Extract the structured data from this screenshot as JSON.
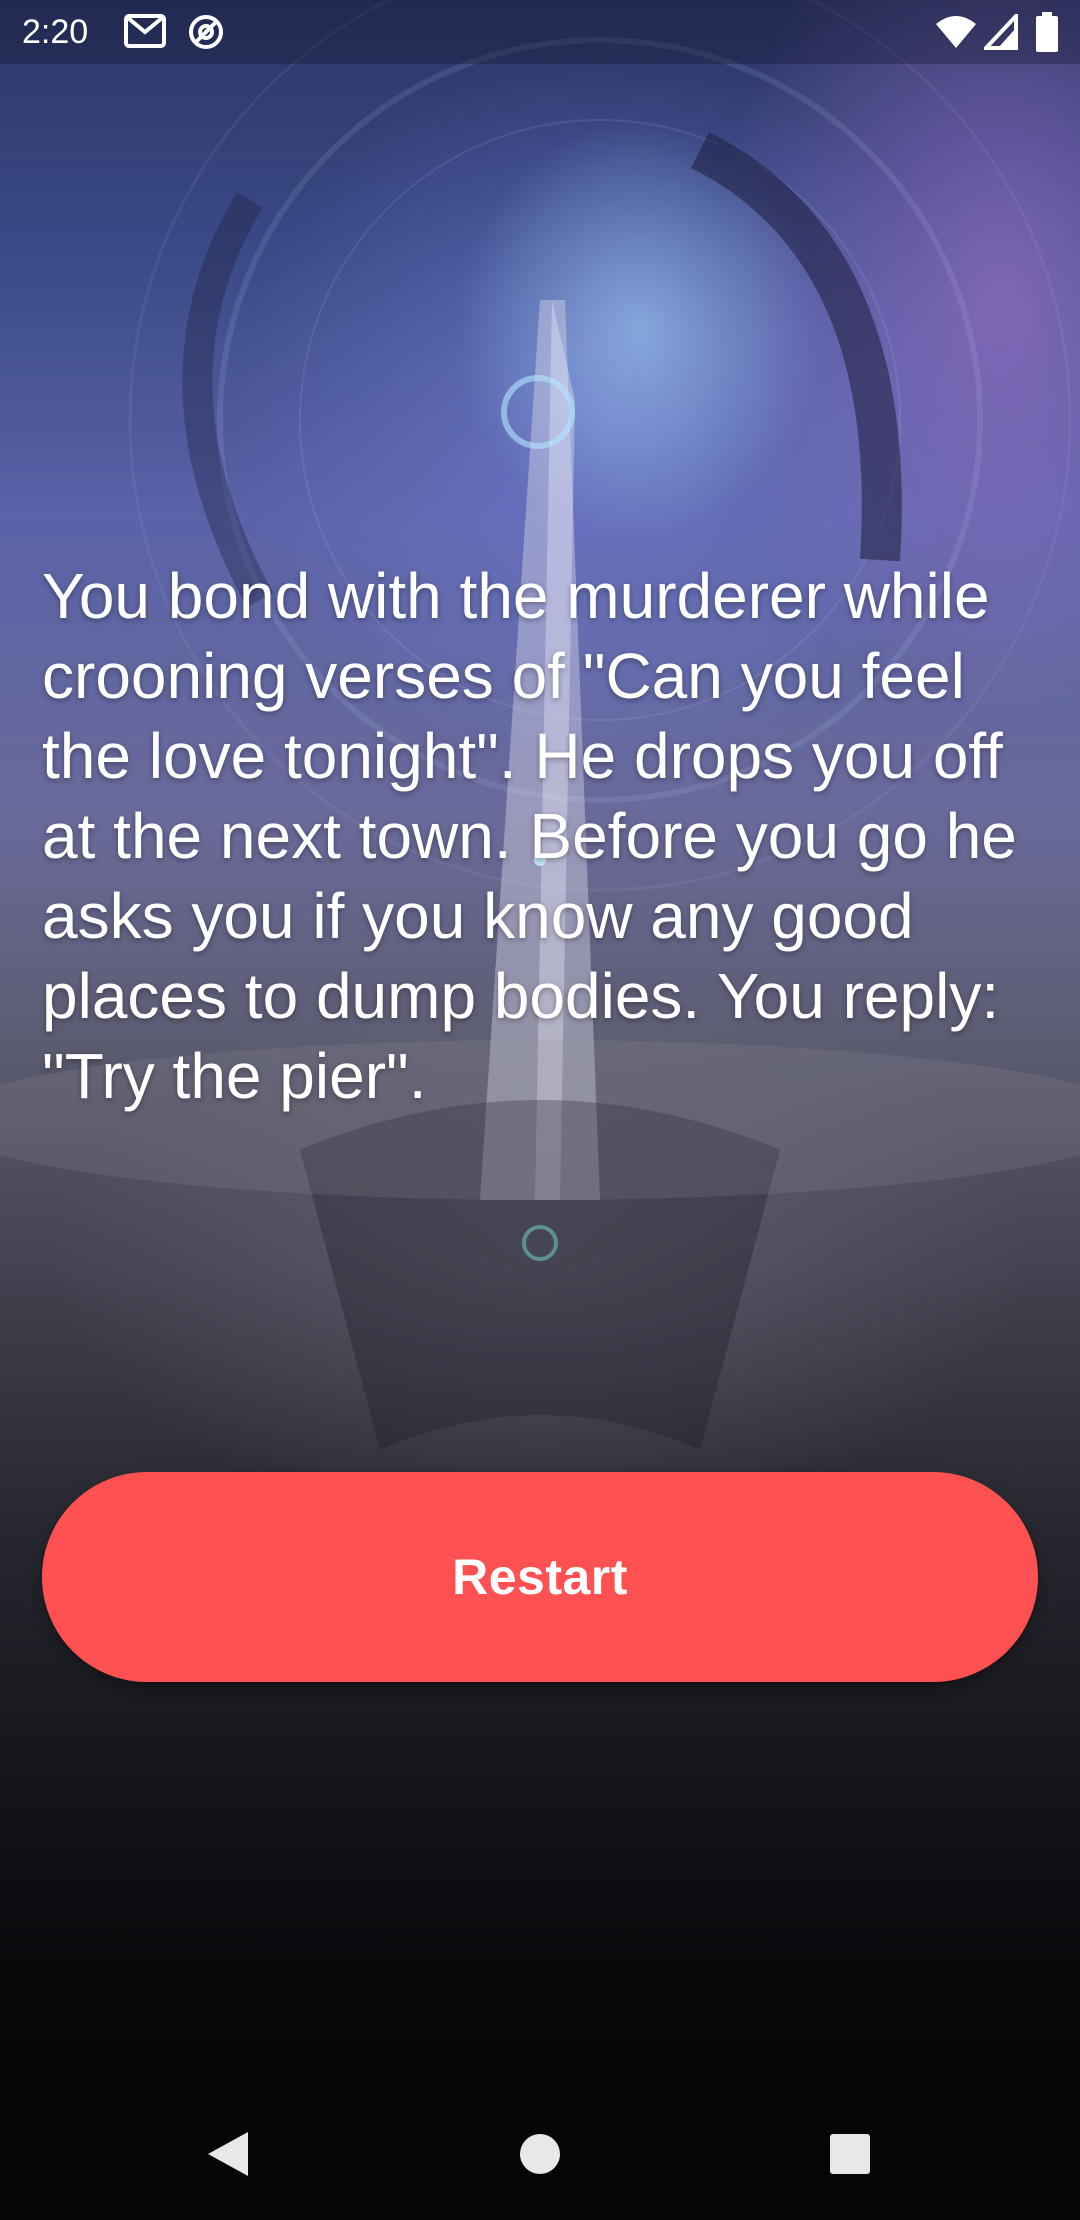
{
  "status_bar": {
    "time": "2:20",
    "left_icons": [
      "gmail-icon",
      "at-sign-icon"
    ],
    "right_icons": [
      "wifi-icon",
      "signal-icon",
      "battery-icon"
    ]
  },
  "story": {
    "text": "You bond with the murderer while crooning verses of \"Can you feel the love tonight\". He drops you off at the next town. Before you go he asks you if you know any good places to dump bodies. You reply: \"Try the pier\"."
  },
  "actions": {
    "restart_label": "Restart"
  },
  "nav_bar": {
    "icons": [
      "back-icon",
      "home-icon",
      "recents-icon"
    ]
  },
  "colors": {
    "button": "#ff5151",
    "text": "#ffffff",
    "background_top": "#3a4a86",
    "background_bottom": "#07070a"
  }
}
